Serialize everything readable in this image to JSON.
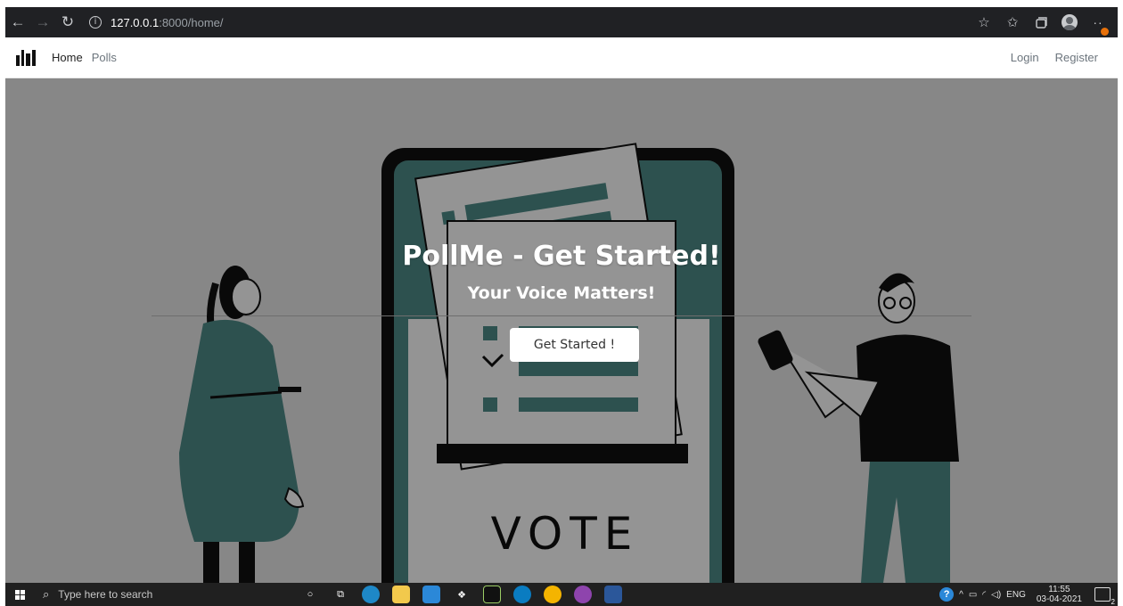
{
  "browser": {
    "address_host": "127.0.0.1",
    "address_path": ":8000/home/",
    "back_icon": "←",
    "forward_icon": "→",
    "reload_icon": "↻",
    "info_icon": "i",
    "more_icon": "··"
  },
  "site": {
    "nav": {
      "home_label": "Home",
      "polls_label": "Polls",
      "login_label": "Login",
      "register_label": "Register"
    }
  },
  "hero": {
    "title": "PollMe - Get Started!",
    "subtitle": "Your Voice Matters!",
    "cta_label": "Get Started !",
    "illustration_text": "VOTE",
    "colors": {
      "accent": "#4f8c89",
      "outline": "#111111",
      "paper": "#ffffff"
    }
  },
  "taskbar": {
    "search_placeholder": "Type here to search",
    "language": "ENG",
    "time": "11:55",
    "date": "03-04-2021",
    "notifications": "2"
  },
  "icons": [
    "back-icon",
    "forward-icon",
    "reload-icon",
    "info-icon",
    "star-icon",
    "favorites-icon",
    "collections-icon",
    "profile-icon",
    "more-icon",
    "windows-icon",
    "search-icon",
    "cortana-icon",
    "task-view-icon",
    "edge-icon",
    "explorer-icon",
    "mail-icon",
    "dropbox-icon",
    "pycharm-icon",
    "edge-dev-icon",
    "chrome-icon",
    "github-icon",
    "word-icon",
    "help-icon",
    "notification-icon"
  ]
}
